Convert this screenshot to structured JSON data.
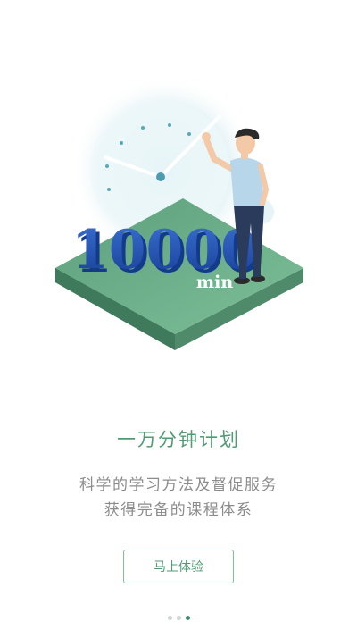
{
  "onboarding": {
    "hero_number": "10000",
    "hero_unit": "min",
    "title": "一万分钟计划",
    "subtitle_line1": "科学的学习方法及督促服务",
    "subtitle_line2": "获得完备的课程体系",
    "cta_label": "马上体验",
    "pager": {
      "total": 3,
      "active_index": 2
    }
  },
  "colors": {
    "accent_green": "#4f9b73",
    "platform_green": "#6aaf8a",
    "number_blue": "#1f4fb3",
    "subtitle_gray": "#8c8c8c"
  }
}
